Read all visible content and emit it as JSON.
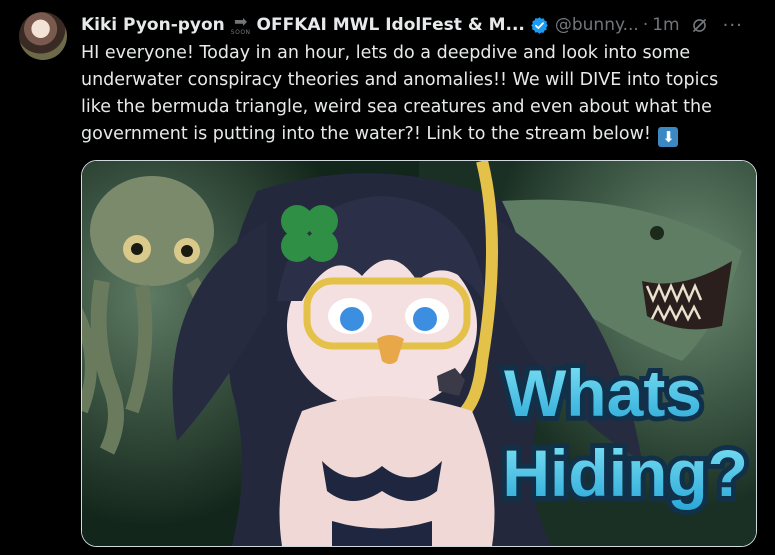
{
  "author": {
    "display_name": "Kiki Pyon-pyon",
    "soon_tag": "SOON",
    "event_name": "OFFKAI MWL IdolFest & M...",
    "handle": "@bunny...",
    "separator": "·",
    "timestamp": "1m",
    "more": "···"
  },
  "post": {
    "text": "HI everyone! Today in an hour, lets do a deepdive and look into some underwater conspiracy theories and anomalies!! We will DIVE into topics like the bermuda triangle, weird sea creatures and even about what the government is putting into the water?! Link to the stream below!",
    "emoji": "⬇"
  },
  "media": {
    "title_line1": "Whats",
    "title_line2": "Hiding?"
  },
  "colors": {
    "verified": "#1d9bf0",
    "muted": "#71767b",
    "title_fill": "#3fc6e6"
  },
  "icons": [
    "verified-badge-icon",
    "grok-icon",
    "more-icon",
    "soon-arrow-icon",
    "down-arrow-emoji"
  ]
}
